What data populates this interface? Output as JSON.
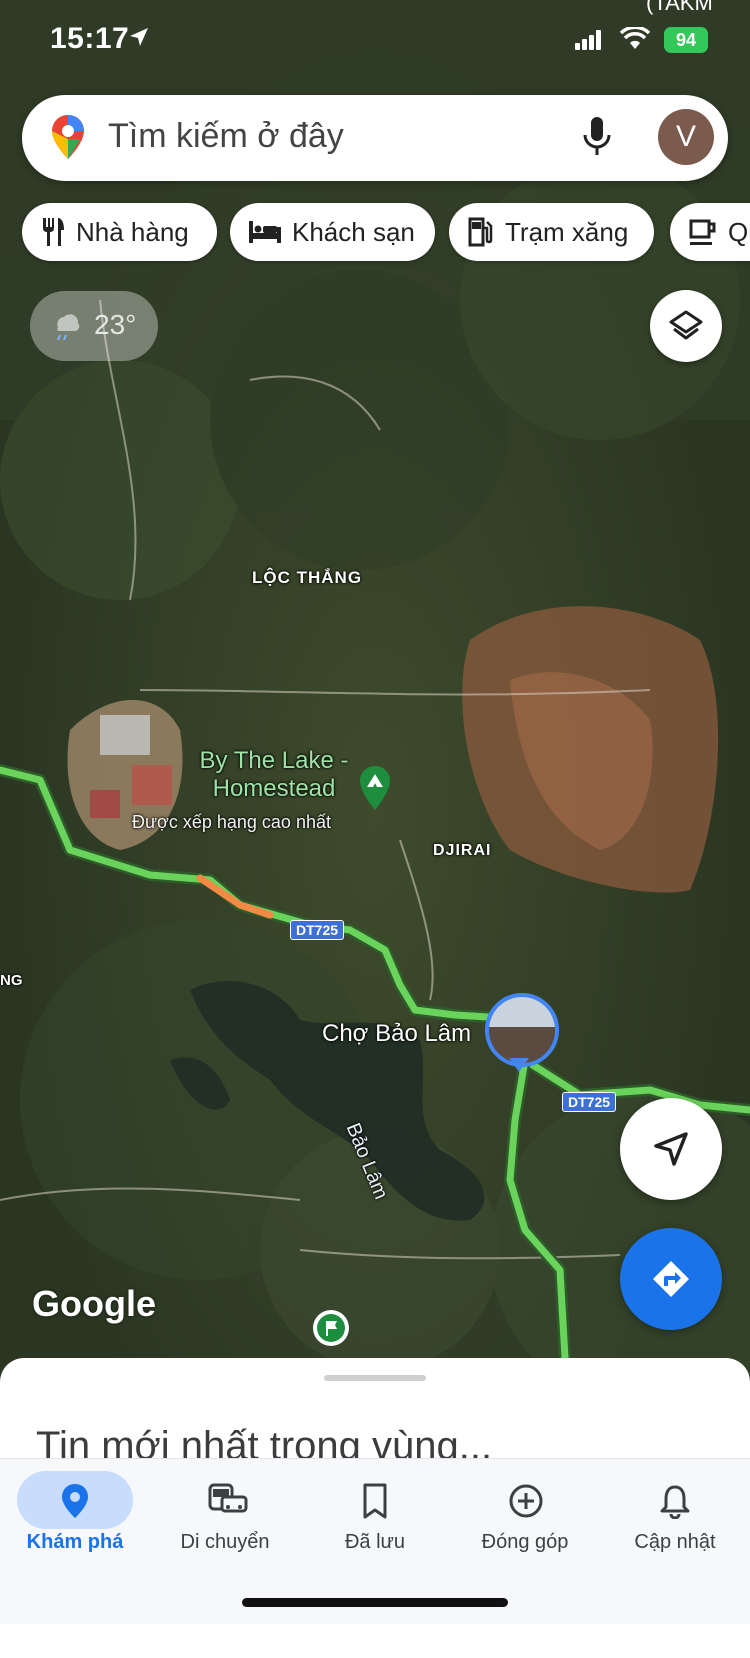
{
  "status_bar": {
    "time": "15:17",
    "battery": "94",
    "top_right_label": "(TAKM"
  },
  "search": {
    "placeholder": "Tìm kiếm ở đây",
    "avatar_letter": "V"
  },
  "chips": [
    {
      "label": "Nhà hàng",
      "icon": "restaurant-icon"
    },
    {
      "label": "Khách sạn",
      "icon": "hotel-icon"
    },
    {
      "label": "Trạm xăng",
      "icon": "gas-station-icon"
    },
    {
      "label": "Qu",
      "icon": "coffee-icon"
    }
  ],
  "weather": {
    "temp": "23°"
  },
  "map": {
    "labels": {
      "loc_thang": "LỘC THẮNG",
      "djirai": "DJIRAI",
      "ng": "NG",
      "cho_bao_lam": "Chợ Bảo Lâm",
      "bao_lam": "Bảo Lâm"
    },
    "poi": {
      "name_line1": "By The Lake -",
      "name_line2": "Homestead",
      "subtitle": "Được xếp hạng cao nhất"
    },
    "road_shield": "DT725",
    "logo": "Google",
    "colors": {
      "route": "#6ad35b",
      "route_orange": "#f08a44",
      "accent": "#1a73e8"
    }
  },
  "sheet": {
    "title": "Tin mới nhất trong vùng..."
  },
  "nav": [
    {
      "label": "Khám phá",
      "icon": "explore-pin-icon",
      "active": true
    },
    {
      "label": "Di chuyển",
      "icon": "commute-icon",
      "active": false
    },
    {
      "label": "Đã lưu",
      "icon": "bookmark-icon",
      "active": false
    },
    {
      "label": "Đóng góp",
      "icon": "add-circle-icon",
      "active": false
    },
    {
      "label": "Cập nhật",
      "icon": "bell-icon",
      "active": false
    }
  ]
}
